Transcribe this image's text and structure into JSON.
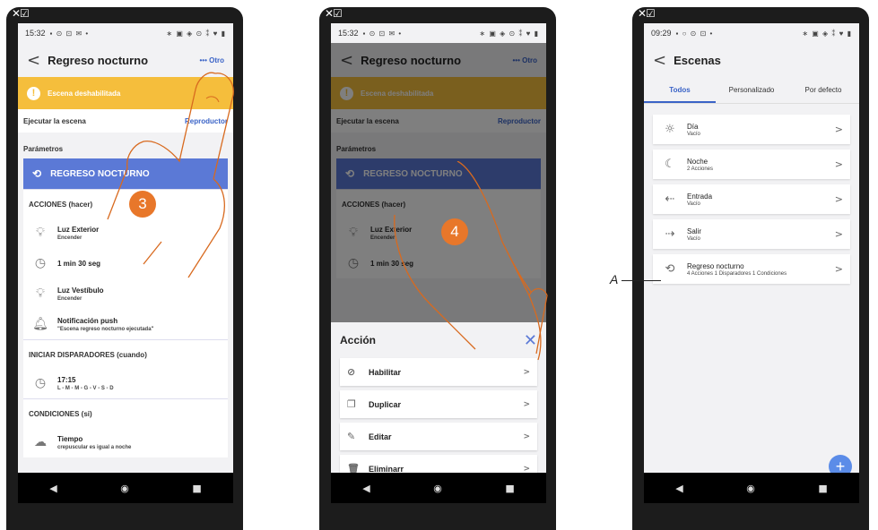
{
  "phone1": {
    "corner_icons": "✕☑",
    "status_time": "15:32",
    "status_left_icons": "▪ ⊙ ⊡ ✉ •",
    "status_right_icons": "∗ ▣ ◈ ⊙ ⁑ ♥ ▮",
    "title": "Regreso nocturno",
    "more_label": "••• Otro",
    "banner_text": "Escena deshabilitada",
    "run_label": "Ejecutar la escena",
    "run_link": "Reproductor",
    "params_label": "Parámetros",
    "scene_name": "REGRESO NOCTURNO",
    "actions_header": "ACCIONES (hacer)",
    "actions": [
      {
        "title": "Luz Exterior",
        "sub": "Encender"
      },
      {
        "title": "1 min 30 seg",
        "sub": ""
      },
      {
        "title": "Luz Vestíbulo",
        "sub": "Encender"
      },
      {
        "title": "Notificación push",
        "sub": "\"Escena regreso nocturno ejecutada\""
      }
    ],
    "triggers_header": "INICIAR DISPARADORES (cuando)",
    "trigger": {
      "title": "17:15",
      "sub": "L - M - M - G - V - S - D"
    },
    "conditions_header": "CONDICIONES (si)",
    "condition": {
      "title": "Tiempo",
      "sub": "crepuscular es igual a noche"
    }
  },
  "phone2": {
    "corner_icons": "✕☑",
    "status_time": "15:32",
    "status_left_icons": "▪ ⊙ ⊡ ✉ •",
    "status_right_icons": "∗ ▣ ◈ ⊙ ⁑ ♥ ▮",
    "sheet_title": "Acción",
    "buttons": [
      {
        "label": "Habilitar"
      },
      {
        "label": "Duplicar"
      },
      {
        "label": "Editar"
      },
      {
        "label": "Eliminarr"
      }
    ]
  },
  "phone3": {
    "corner_icons": "✕☑",
    "status_time": "09:29",
    "status_left_icons": "▪ ○ ⊙ ⊡ •",
    "status_right_icons": "∗ ▣ ◈ ⁑ ♥ ▮",
    "title": "Escenas",
    "tabs": [
      "Todos",
      "Personalizado",
      "Por defecto"
    ],
    "scenes": [
      {
        "name": "Día",
        "desc": "Vacío"
      },
      {
        "name": "Noche",
        "desc": "2 Acciones"
      },
      {
        "name": "Entrada",
        "desc": "Vacío"
      },
      {
        "name": "Salir",
        "desc": "Vacío"
      },
      {
        "name": "Regreso nocturno",
        "desc": "4 Acciones 1 Disparadores 1 Condiciones"
      }
    ]
  },
  "steps": {
    "step3": "3",
    "step4": "4"
  },
  "annotation": {
    "label": "A"
  },
  "nav": {
    "back": "◀",
    "home": "◉",
    "recent": "■"
  },
  "colors": {
    "accent": "#3a63c7",
    "scene_header": "#5b79d6",
    "banner": "#f5be3c",
    "step_badge": "#e8772a",
    "fab": "#5b8ce8"
  }
}
